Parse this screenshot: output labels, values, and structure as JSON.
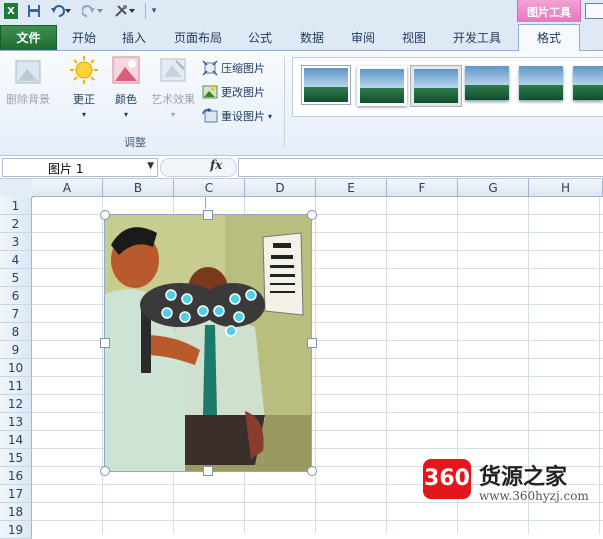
{
  "quick_access": {
    "save_icon": "save-icon",
    "undo_icon": "undo-icon",
    "redo_icon": "redo-icon",
    "customize_icon": "customize-icon"
  },
  "context_tab_header": "图片工具",
  "tabs": [
    {
      "label": "文件"
    },
    {
      "label": "开始"
    },
    {
      "label": "插入"
    },
    {
      "label": "页面布局"
    },
    {
      "label": "公式"
    },
    {
      "label": "数据"
    },
    {
      "label": "审阅"
    },
    {
      "label": "视图"
    },
    {
      "label": "开发工具"
    },
    {
      "label": "格式"
    }
  ],
  "ribbon": {
    "remove_background": "删除背景",
    "corrections": "更正",
    "color": "颜色",
    "artistic_effects": "艺术效果",
    "compress": "压缩图片",
    "change": "更改图片",
    "reset": "重设图片",
    "group_label": "调整"
  },
  "formula_bar": {
    "name_box": "图片 1",
    "fx": "fx",
    "formula": ""
  },
  "columns": [
    "A",
    "B",
    "C",
    "D",
    "E",
    "F",
    "G",
    "H"
  ],
  "rows": [
    "1",
    "2",
    "3",
    "4",
    "5",
    "6",
    "7",
    "8",
    "9",
    "10",
    "11",
    "12",
    "13",
    "14",
    "15",
    "16",
    "17",
    "18",
    "19"
  ],
  "watermark": {
    "badge": "360",
    "title": "货源之家",
    "url": "www.360hyzj.com"
  },
  "colors": {
    "file_tab": "#2a7c3b",
    "context_tab": "#e777c0",
    "watermark_red": "#e4151b"
  }
}
